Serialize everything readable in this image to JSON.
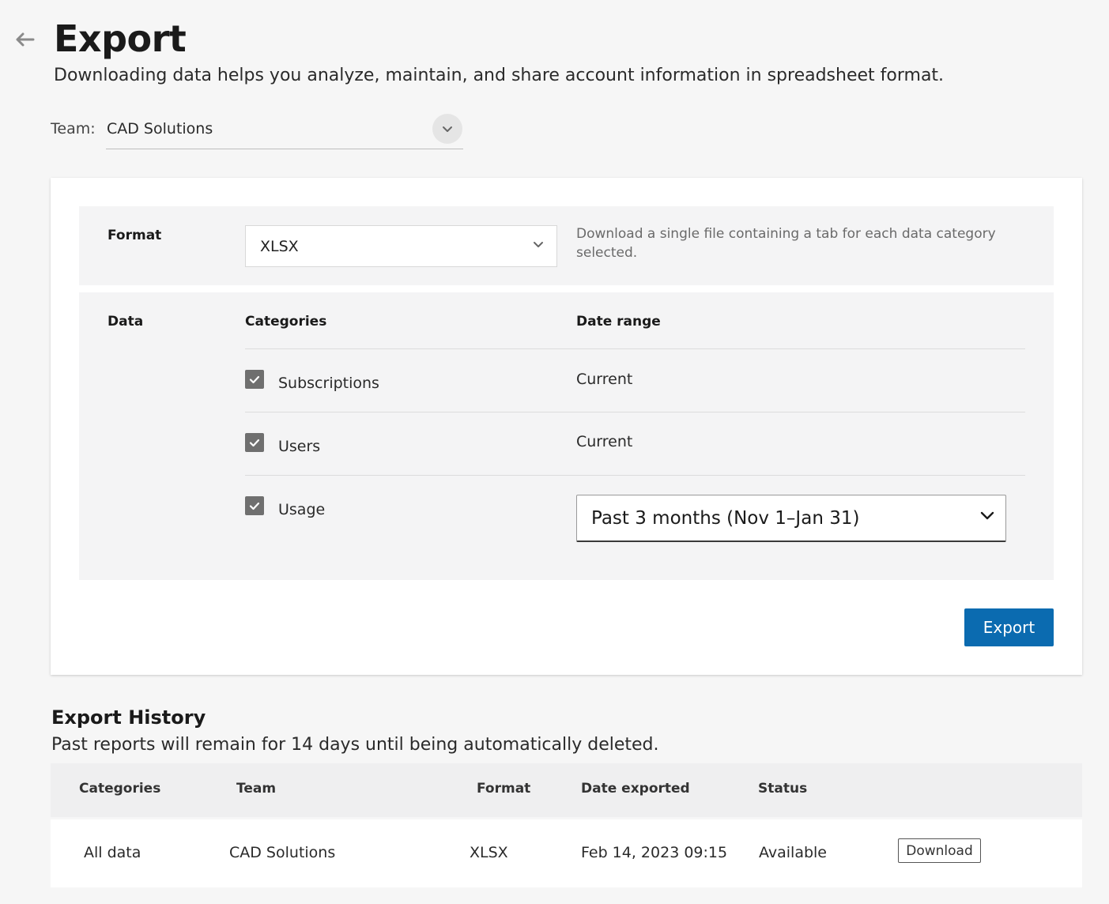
{
  "header": {
    "title": "Export",
    "subtitle": "Downloading data helps you analyze, maintain, and share account information in spreadsheet format."
  },
  "team": {
    "label": "Team:",
    "value": "CAD Solutions"
  },
  "format": {
    "label": "Format",
    "value": "XLSX",
    "description": "Download a single file containing a tab for each data category selected."
  },
  "data": {
    "label": "Data",
    "categories_header": "Categories",
    "date_range_header": "Date range",
    "rows": [
      {
        "category": "Subscriptions",
        "checked": true,
        "date_range": "Current"
      },
      {
        "category": "Users",
        "checked": true,
        "date_range": "Current"
      },
      {
        "category": "Usage",
        "checked": true,
        "date_range": "Past 3 months (Nov 1–Jan 31)"
      }
    ]
  },
  "actions": {
    "export_label": "Export"
  },
  "history": {
    "title": "Export History",
    "subtitle": "Past reports will remain for 14 days until being automatically deleted.",
    "columns": [
      "Categories",
      "Team",
      "Format",
      "Date exported",
      "Status"
    ],
    "rows": [
      {
        "categories": "All data",
        "team": "CAD Solutions",
        "format": "XLSX",
        "date_exported": "Feb 14, 2023 09:15",
        "status": "Available",
        "action_label": "Download"
      }
    ]
  },
  "colors": {
    "primary": "#0b6bb0",
    "checkbox": "#6f6f6f",
    "panel": "#f4f4f5",
    "background": "#f6f6f6"
  },
  "icons": {
    "back": "arrow-left-icon",
    "team_dropdown": "chevron-down-icon",
    "format_dropdown": "chevron-down-icon",
    "range_dropdown": "chevron-down-icon",
    "checkbox": "checkmark-icon"
  }
}
